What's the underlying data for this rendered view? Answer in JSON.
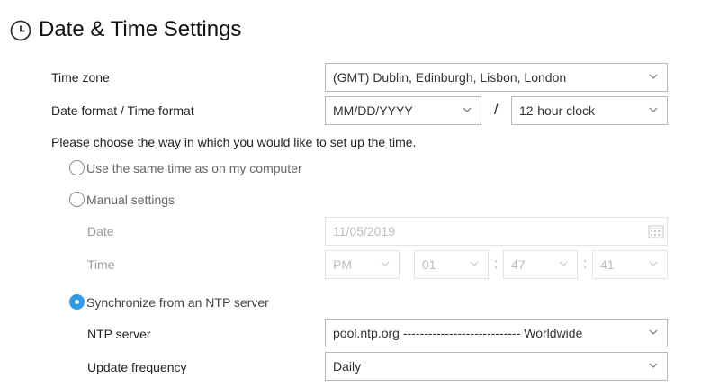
{
  "page": {
    "title": "Date & Time Settings"
  },
  "time_zone": {
    "label": "Time zone",
    "value": "(GMT) Dublin, Edinburgh, Lisbon, London"
  },
  "format": {
    "label": "Date format / Time format",
    "date_value": "MM/DD/YYYY",
    "separator": "/",
    "time_value": "12-hour clock"
  },
  "instruction": "Please choose the way in which you would like to set up the time.",
  "options": {
    "computer": "Use the same time as on my computer",
    "manual": "Manual settings",
    "ntp": "Synchronize from an NTP server",
    "selected": "ntp"
  },
  "manual": {
    "date_label": "Date",
    "date_value": "11/05/2019",
    "time_label": "Time",
    "ampm": "PM",
    "hour": "01",
    "minute": "47",
    "second": "41",
    "colon": ":"
  },
  "ntp": {
    "server_label": "NTP server",
    "server_value": "pool.ntp.org ---------------------------- Worldwide",
    "frequency_label": "Update frequency",
    "frequency_value": "Daily"
  },
  "colors": {
    "accent": "#2f9be8"
  }
}
